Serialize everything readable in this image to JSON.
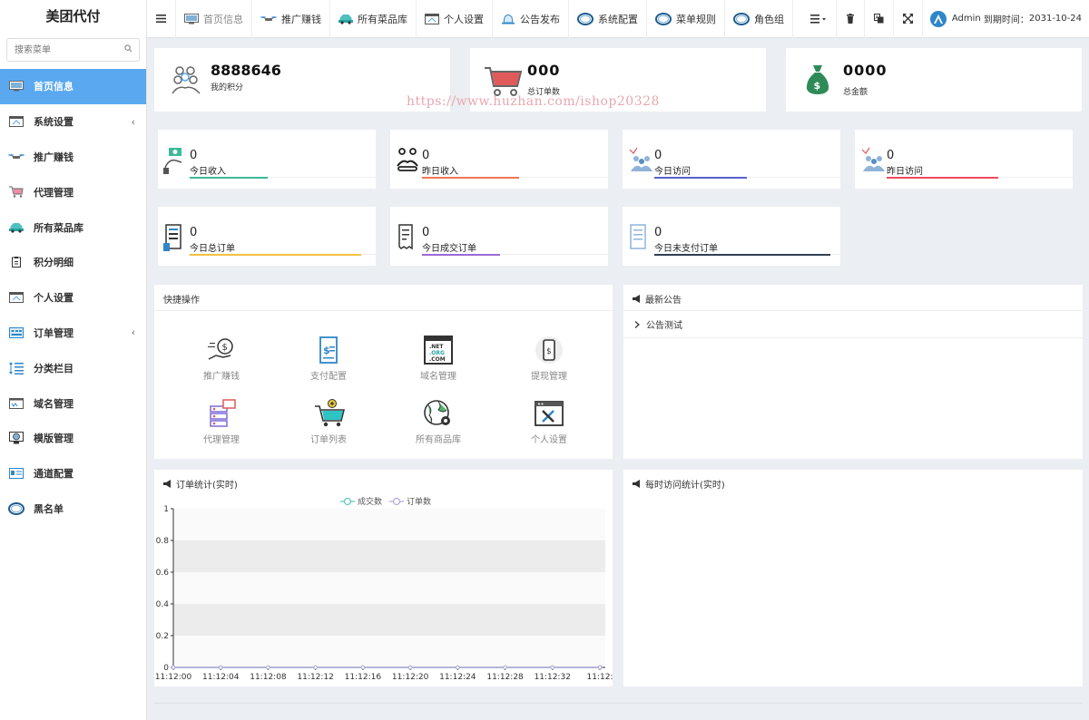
{
  "app": {
    "title": "美团代付",
    "search_placeholder": "搜索菜单"
  },
  "sidebar": {
    "items": [
      {
        "label": "首页信息",
        "icon": "monitor-icon",
        "active": true
      },
      {
        "label": "系统设置",
        "icon": "window-icon",
        "has_arrow": true
      },
      {
        "label": "推广赚钱",
        "icon": "drone-icon"
      },
      {
        "label": "代理管理",
        "icon": "cart-icon"
      },
      {
        "label": "所有菜品库",
        "icon": "car-icon"
      },
      {
        "label": "积分明细",
        "icon": "clipboard-icon"
      },
      {
        "label": "个人设置",
        "icon": "window-icon"
      },
      {
        "label": "订单管理",
        "icon": "register-icon",
        "has_arrow": true
      },
      {
        "label": "分类栏目",
        "icon": "sort-icon"
      },
      {
        "label": "域名管理",
        "icon": "chart-window-icon"
      },
      {
        "label": "模版管理",
        "icon": "web-icon"
      },
      {
        "label": "通道配置",
        "icon": "id-card-icon"
      },
      {
        "label": "黑名单",
        "icon": "ring-icon"
      }
    ]
  },
  "topnav": {
    "menu_icon": "hamburger-icon",
    "tabs": [
      {
        "label": "首页信息",
        "icon": "monitor-icon",
        "disabled": true
      },
      {
        "label": "推广赚钱",
        "icon": "drone-icon"
      },
      {
        "label": "所有菜品库",
        "icon": "car-icon"
      },
      {
        "label": "个人设置",
        "icon": "window-icon"
      },
      {
        "label": "公告发布",
        "icon": "bell-icon"
      },
      {
        "label": "系统配置",
        "icon": "ring-icon"
      },
      {
        "label": "菜单规则",
        "icon": "ring-icon"
      },
      {
        "label": "角色组",
        "icon": "ring-icon"
      }
    ],
    "user": {
      "name": "Admin",
      "expire_label": "到期时间：",
      "expire_date": "2031-10-24"
    }
  },
  "summary": [
    {
      "value": "8888646",
      "label": "我的积分",
      "icon": "coins-people-icon"
    },
    {
      "value": "000",
      "label": "总订单数",
      "icon": "shopping-cart-icon"
    },
    {
      "value": "0000",
      "label": "总金额",
      "icon": "money-bag-icon"
    }
  ],
  "stats": [
    {
      "value": "0",
      "label": "今日收入",
      "icon": "income-icon",
      "color": "#3cb89a"
    },
    {
      "value": "0",
      "label": "昨日收入",
      "icon": "handshake-icon",
      "color": "#f07655"
    },
    {
      "value": "0",
      "label": "今日访问",
      "icon": "visitors-icon",
      "color": "#5a60c8"
    },
    {
      "value": "0",
      "label": "昨日访问",
      "icon": "visitors-icon",
      "color": "#ee4a5c"
    },
    {
      "value": "0",
      "label": "今日总订单",
      "icon": "order-doc-icon",
      "color": "#f5c242"
    },
    {
      "value": "0",
      "label": "今日成交订单",
      "icon": "receipt-icon",
      "color": "#9b6ad6"
    },
    {
      "value": "0",
      "label": "今日未支付订单",
      "icon": "unpaid-doc-icon",
      "color": "#2f3e52"
    }
  ],
  "quick_actions": {
    "title": "快捷操作",
    "items": [
      {
        "label": "推广赚钱",
        "icon": "money-hand-icon"
      },
      {
        "label": "支付配置",
        "icon": "invoice-icon"
      },
      {
        "label": "域名管理",
        "icon": "domain-icon"
      },
      {
        "label": "提现管理",
        "icon": "phone-money-icon"
      },
      {
        "label": "代理管理",
        "icon": "agent-icon"
      },
      {
        "label": "订单列表",
        "icon": "cart-add-icon"
      },
      {
        "label": "所有商品库",
        "icon": "globe-gear-icon"
      },
      {
        "label": "个人设置",
        "icon": "settings-window-icon"
      }
    ]
  },
  "notices": {
    "title": "最新公告",
    "items": [
      {
        "label": "公告测试"
      }
    ]
  },
  "order_chart": {
    "title": "订单统计(实时)"
  },
  "visit_chart": {
    "title": "每时访问统计(实时)"
  },
  "watermark": "https://www.huzhan.com/ishop20328",
  "chart_data": {
    "type": "line",
    "x": [
      "11:12:00",
      "11:12:04",
      "11:12:08",
      "11:12:12",
      "11:12:16",
      "11:12:20",
      "11:12:24",
      "11:12:28",
      "11:12:32",
      "11:12:"
    ],
    "series": [
      {
        "name": "成交数",
        "values": [
          0,
          0,
          0,
          0,
          0,
          0,
          0,
          0,
          0,
          0
        ],
        "color": "#5ec5c5"
      },
      {
        "name": "订单数",
        "values": [
          0,
          0,
          0,
          0,
          0,
          0,
          0,
          0,
          0,
          0
        ],
        "color": "#b6a6d8"
      }
    ],
    "ylim": [
      0,
      1
    ],
    "yticks": [
      "0",
      "0.2",
      "0.4",
      "0.6",
      "0.8",
      "1"
    ],
    "legend": "top-center",
    "grid": true
  }
}
